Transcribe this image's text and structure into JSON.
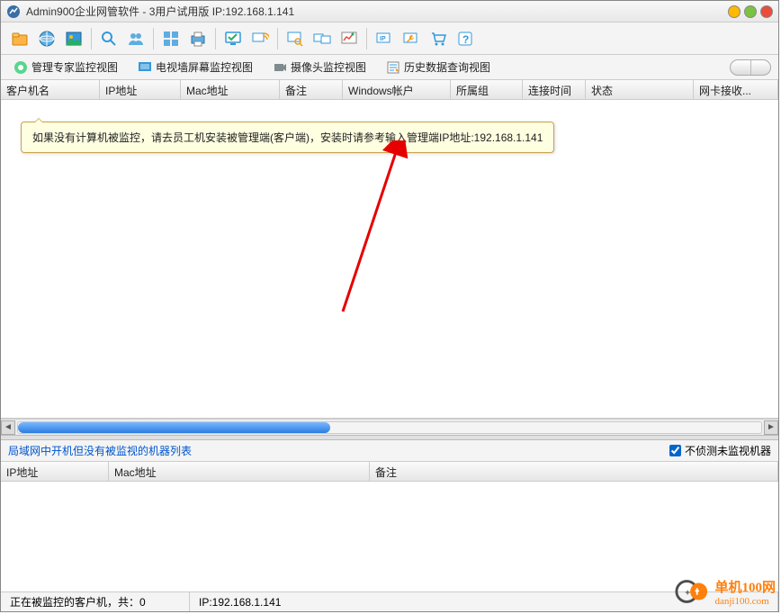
{
  "titlebar": {
    "title": "Admin900企业网管软件 - 3用户试用版 IP:192.168.1.141"
  },
  "tabs": {
    "t1": "管理专家监控视图",
    "t2": "电视墙屏幕监控视图",
    "t3": "摄像头监控视图",
    "t4": "历史数据查询视图"
  },
  "main_columns": {
    "c0": "客户机名",
    "c1": "IP地址",
    "c2": "Mac地址",
    "c3": "备注",
    "c4": "Windows帐户",
    "c5": "所属组",
    "c6": "连接时间",
    "c7": "状态",
    "c8": "网卡接收..."
  },
  "tooltip": {
    "text": "如果没有计算机被监控，请去员工机安装被管理端(客户端)，安装时请参考输入管理端IP地址:192.168.1.141"
  },
  "lower": {
    "title": "局域网中开机但没有被监视的机器列表",
    "checkbox": "不侦测未监视机器",
    "columns": {
      "c0": "IP地址",
      "c1": "Mac地址",
      "c2": "备注"
    }
  },
  "status": {
    "left": "正在被监控的客户机，共：0",
    "ip": "IP:192.168.1.141"
  },
  "watermark": {
    "line1": "单机100网",
    "line2": "danji100.com"
  }
}
